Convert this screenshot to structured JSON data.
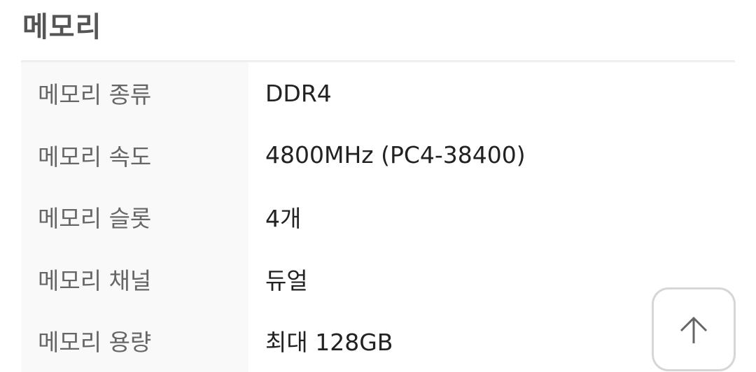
{
  "title": "메모리",
  "rows": [
    {
      "label": "메모리 종류",
      "value": "DDR4"
    },
    {
      "label": "메모리 속도",
      "value": "4800MHz (PC4-38400)"
    },
    {
      "label": "메모리 슬롯",
      "value": "4개"
    },
    {
      "label": "메모리 채널",
      "value": "듀얼"
    },
    {
      "label": "메모리 용량",
      "value": "최대 128GB"
    }
  ]
}
